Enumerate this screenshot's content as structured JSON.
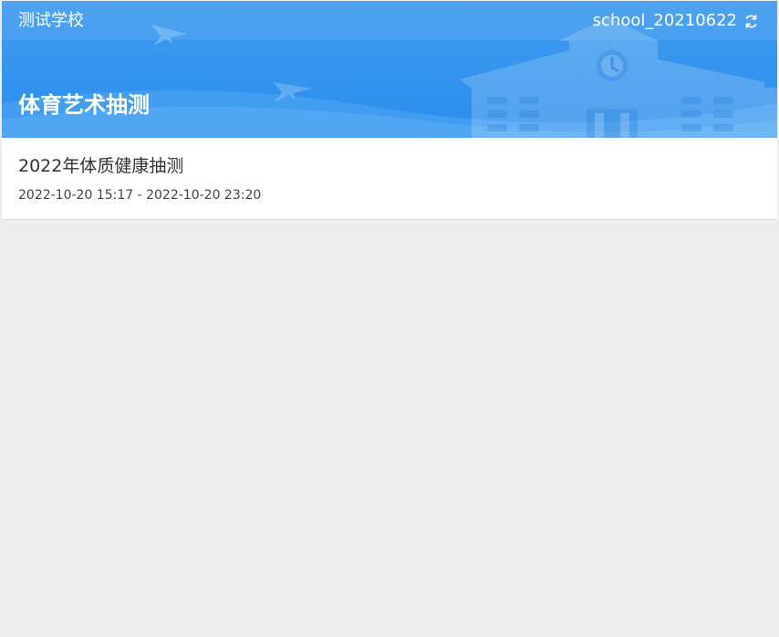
{
  "header": {
    "school_name": "测试学校",
    "account_name": "school_20210622",
    "refresh_icon": "refresh-icon",
    "page_title": "体育艺术抽测",
    "background_color": "#2b8ded"
  },
  "tasks": [
    {
      "title": "2022年体质健康抽测",
      "time_range": "2022-10-20 15:17 - 2022-10-20 23:20"
    }
  ]
}
